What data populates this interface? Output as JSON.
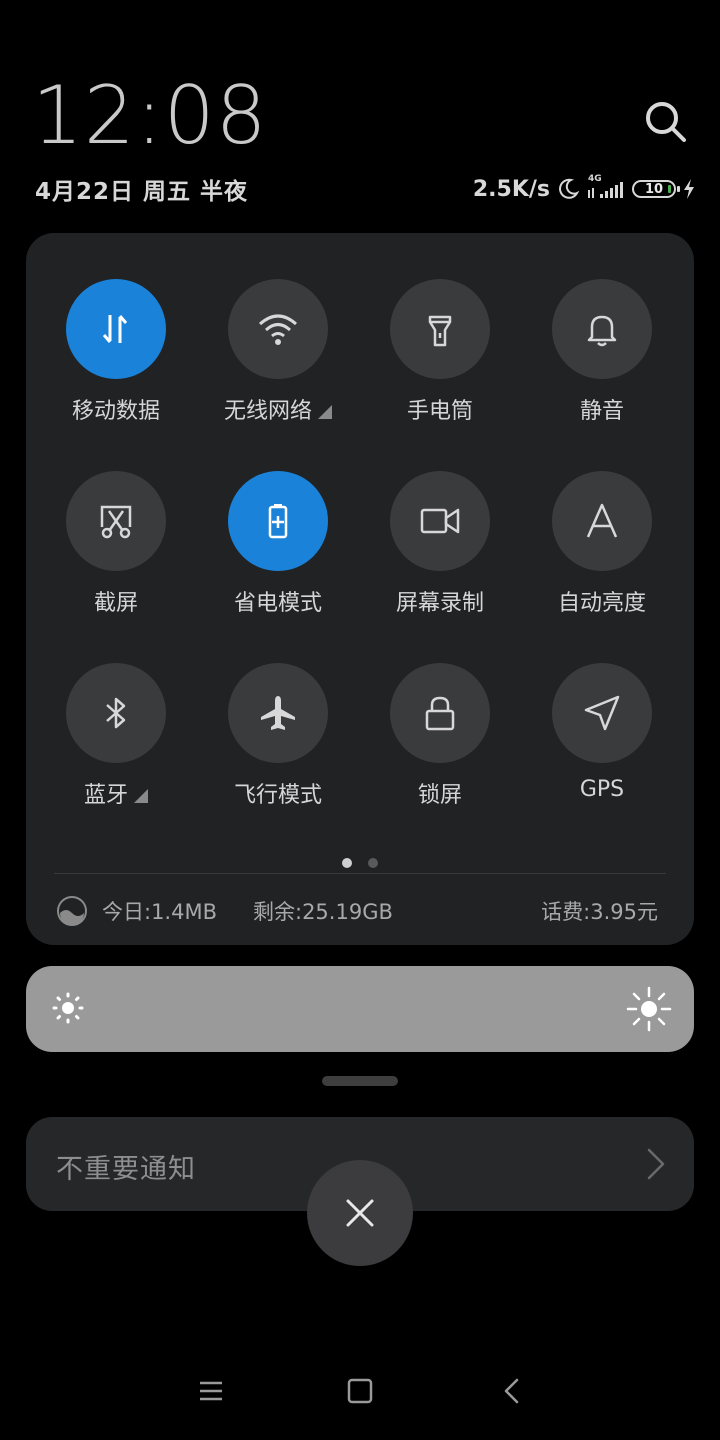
{
  "header": {
    "time": "12:08",
    "date": "4月22日 周五 半夜",
    "net_speed": "2.5K/s",
    "network_type": "4G",
    "battery_level": "10"
  },
  "tiles": [
    {
      "label": "移动数据",
      "icon": "mobile-data-icon",
      "active": true
    },
    {
      "label": "无线网络",
      "icon": "wifi-icon",
      "active": false,
      "expand": true
    },
    {
      "label": "手电筒",
      "icon": "flashlight-icon",
      "active": false
    },
    {
      "label": "静音",
      "icon": "bell-icon",
      "active": false
    },
    {
      "label": "截屏",
      "icon": "screenshot-icon",
      "active": false
    },
    {
      "label": "省电模式",
      "icon": "battery-saver-icon",
      "active": true
    },
    {
      "label": "屏幕录制",
      "icon": "video-camera-icon",
      "active": false
    },
    {
      "label": "自动亮度",
      "icon": "auto-brightness-icon",
      "active": false
    },
    {
      "label": "蓝牙",
      "icon": "bluetooth-icon",
      "active": false,
      "expand": true
    },
    {
      "label": "飞行模式",
      "icon": "airplane-icon",
      "active": false
    },
    {
      "label": "锁屏",
      "icon": "lock-icon",
      "active": false
    },
    {
      "label": "GPS",
      "icon": "location-arrow-icon",
      "active": false
    }
  ],
  "pager": {
    "pages": 2,
    "current": 1
  },
  "usage": {
    "today": "今日:1.4MB",
    "remaining": "剩余:25.19GB",
    "balance": "话费:3.95元"
  },
  "notification": {
    "label": "不重要通知"
  },
  "colors": {
    "active_tile": "#1a82d9",
    "inactive_tile": "#3a3b3d",
    "panel": "#212224"
  }
}
